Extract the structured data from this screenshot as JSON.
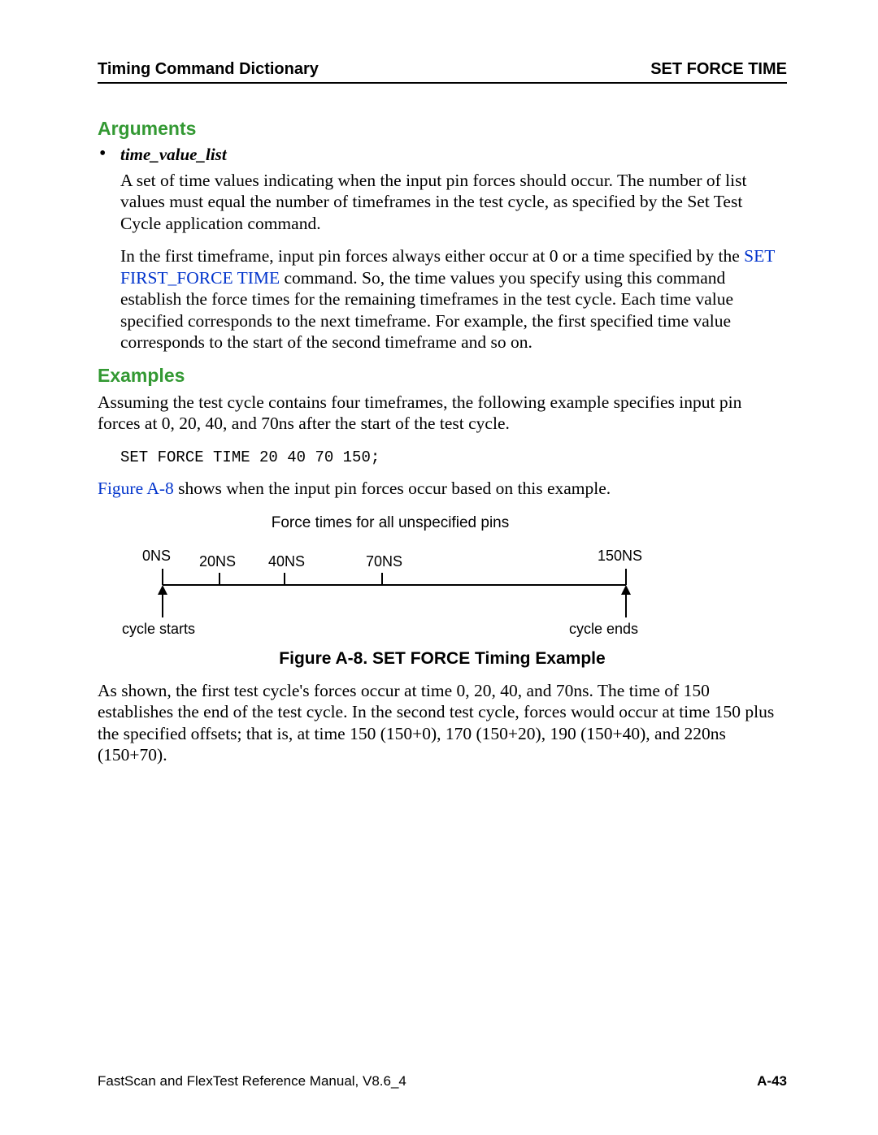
{
  "header": {
    "left": "Timing Command Dictionary",
    "right": "SET FORCE TIME"
  },
  "arguments": {
    "heading": "Arguments",
    "arg_name": "time_value_list",
    "para1": "A set of time values indicating when the input pin forces should occur. The number of list values must equal the number of timeframes in the test cycle, as specified by the Set Test Cycle application command.",
    "para2_pre": "In the first timeframe, input pin forces always either occur at 0 or a time specified by the ",
    "para2_link": "SET FIRST_FORCE TIME",
    "para2_post": " command. So, the time values you specify using this command establish the force times for the remaining timeframes in the test cycle. Each time value specified corresponds to the next timeframe. For example, the first specified time value corresponds to the start of the second timeframe and so on."
  },
  "examples": {
    "heading": "Examples",
    "intro": "Assuming the test cycle contains four timeframes, the following example specifies input pin forces at 0, 20, 40, and 70ns after the start of the test cycle.",
    "code": "SET FORCE TIME 20 40 70 150;",
    "ref_pre_link": "Figure A-8",
    "ref_post": " shows when the input pin forces occur based on this example.",
    "diagram": {
      "title": "Force times for all unspecified pins",
      "ticks": {
        "t0": "0NS",
        "t20": "20NS",
        "t40": "40NS",
        "t70": "70NS",
        "t150": "150NS"
      },
      "labels": {
        "start": "cycle starts",
        "end": "cycle ends"
      }
    },
    "figure_caption": "Figure A-8. SET FORCE Timing Example",
    "after_figure": "As shown, the first test cycle's forces occur at time 0, 20, 40, and 70ns. The time of 150 establishes the end of the test cycle. In the second test cycle, forces would occur at time 150 plus the specified offsets; that is, at time 150 (150+0), 170 (150+20), 190 (150+40), and 220ns (150+70)."
  },
  "footer": {
    "left": "FastScan and FlexTest Reference Manual, V8.6_4",
    "right": "A-43"
  }
}
